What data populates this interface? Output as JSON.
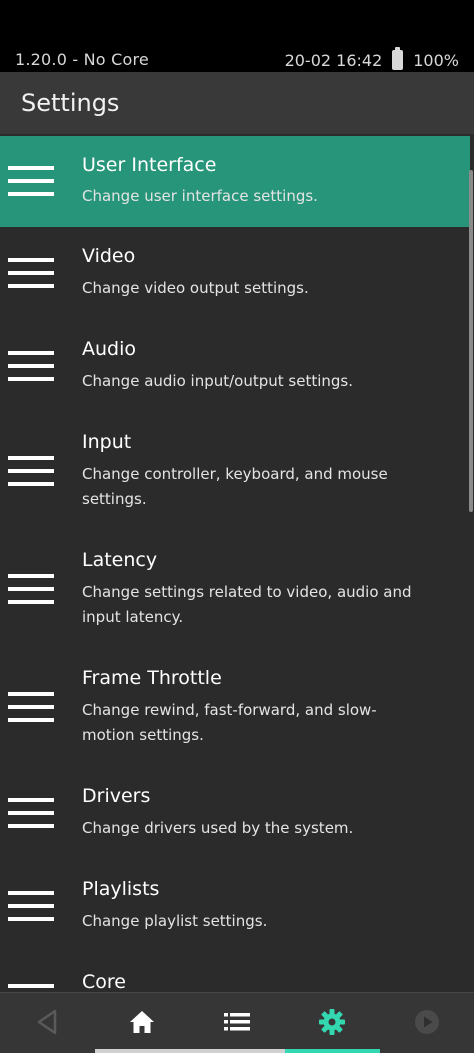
{
  "status_bar": {
    "left_text": "1.20.0 - No Core",
    "datetime": "20-02 16:42",
    "battery": "100%"
  },
  "header": {
    "title": "Settings"
  },
  "menu_items": [
    {
      "title": "User Interface",
      "desc": "Change user interface settings.",
      "selected": true
    },
    {
      "title": "Video",
      "desc": "Change video output settings."
    },
    {
      "title": "Audio",
      "desc": "Change audio input/output settings."
    },
    {
      "title": "Input",
      "desc": "Change controller, keyboard, and mouse settings."
    },
    {
      "title": "Latency",
      "desc": "Change settings related to video, audio and input latency."
    },
    {
      "title": "Frame Throttle",
      "desc": "Change rewind, fast-forward, and slow-motion settings."
    },
    {
      "title": "Drivers",
      "desc": "Change drivers used by the system."
    },
    {
      "title": "Playlists",
      "desc": "Change playlist settings."
    },
    {
      "title": "Core",
      "desc": ""
    }
  ],
  "bottom_nav": {
    "items": [
      "back-icon",
      "home-icon",
      "list-icon",
      "settings-icon",
      "play-icon"
    ],
    "active": "settings-icon",
    "colors": {
      "active": "#34d8b0",
      "normal": "#ffffff",
      "disabled": "#5a5a5a"
    }
  },
  "colors": {
    "accent": "#26957a",
    "background": "#2b2b2b",
    "header": "#393939"
  }
}
